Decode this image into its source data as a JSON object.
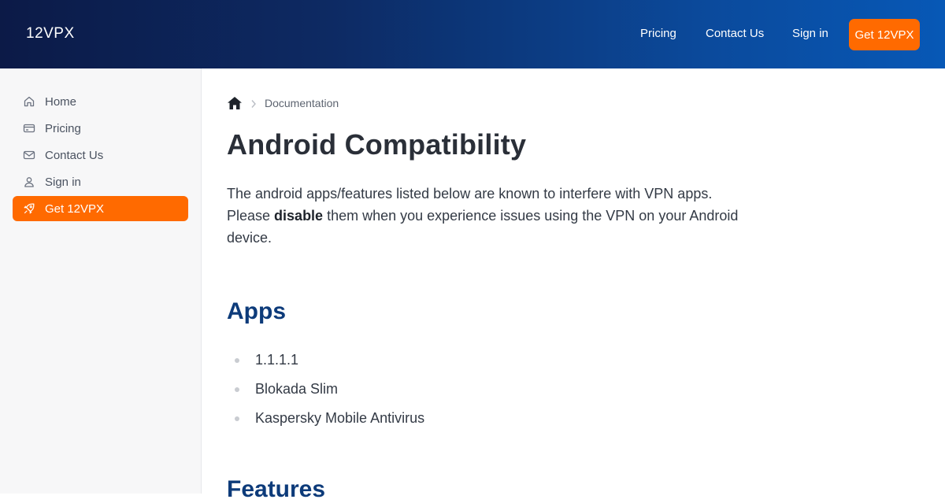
{
  "header": {
    "brand": "12VPX",
    "nav": [
      {
        "label": "Pricing"
      },
      {
        "label": "Contact Us"
      },
      {
        "label": "Sign in"
      }
    ],
    "cta_label": "Get 12VPX"
  },
  "sidebar": {
    "items": [
      {
        "label": "Home",
        "icon": "home-icon"
      },
      {
        "label": "Pricing",
        "icon": "credit-card-icon"
      },
      {
        "label": "Contact Us",
        "icon": "mail-icon"
      },
      {
        "label": "Sign in",
        "icon": "user-icon"
      },
      {
        "label": "Get 12VPX",
        "icon": "rocket-icon",
        "active": true
      }
    ]
  },
  "breadcrumb": {
    "current": "Documentation"
  },
  "page": {
    "title": "Android Compatibility",
    "intro_part1": "The android apps/features listed below are known to interfere with VPN apps. Please ",
    "intro_bold": "disable",
    "intro_part2": " them when you experience issues using the VPN on your Android device.",
    "apps_heading": "Apps",
    "apps": [
      "1.1.1.1",
      "Blokada Slim",
      "Kaspersky Mobile Antivirus"
    ],
    "features_heading": "Features"
  },
  "colors": {
    "accent": "#ff6a00",
    "header_start": "#0c1a47",
    "header_end": "#0758b6",
    "heading_blue": "#0d3b7a"
  }
}
